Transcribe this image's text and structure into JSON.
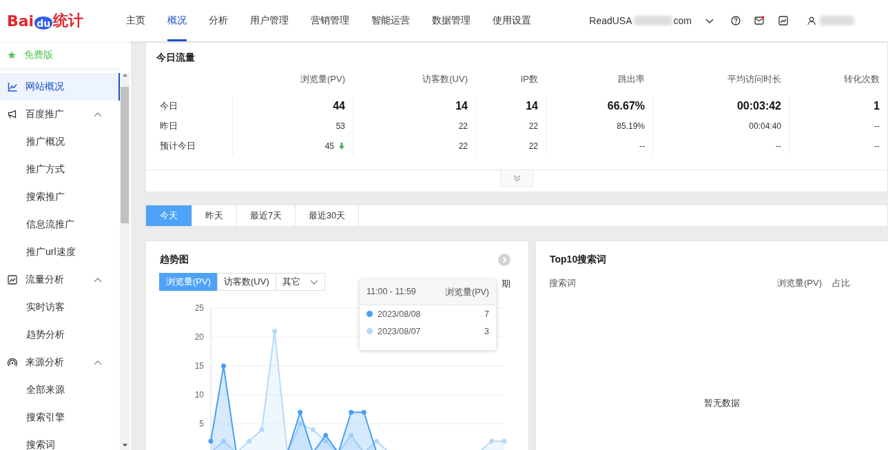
{
  "header": {
    "logo": {
      "part_1": "Bai",
      "part_2": "du",
      "part_3": "统计"
    },
    "nav": [
      {
        "label": "主页",
        "selected": false
      },
      {
        "label": "概况",
        "selected": true
      },
      {
        "label": "分析",
        "selected": false
      },
      {
        "label": "用户管理",
        "selected": false
      },
      {
        "label": "营销管理",
        "selected": false
      },
      {
        "label": "智能运营",
        "selected": false
      },
      {
        "label": "数据管理",
        "selected": false
      },
      {
        "label": "使用设置",
        "selected": false
      }
    ],
    "account": {
      "prefix": "ReadUSA",
      "suffix": "com"
    },
    "notifications_unread": true
  },
  "sidebar": {
    "edition": "免费版",
    "items": [
      {
        "label": "网站概况",
        "selected": true
      },
      {
        "label": "百度推广",
        "selected": false,
        "expanded": true,
        "children": [
          {
            "label": "推广概况",
            "selected": false
          },
          {
            "label": "推广方式",
            "selected": false
          },
          {
            "label": "搜索推广",
            "selected": false
          },
          {
            "label": "信息流推广",
            "selected": false
          },
          {
            "label": "推广url速度",
            "selected": false
          }
        ]
      },
      {
        "label": "流量分析",
        "selected": false,
        "expanded": true,
        "children": [
          {
            "label": "实时访客",
            "selected": false
          },
          {
            "label": "趋势分析",
            "selected": false
          }
        ]
      },
      {
        "label": "来源分析",
        "selected": false,
        "expanded": true,
        "children": [
          {
            "label": "全部来源",
            "selected": false
          },
          {
            "label": "搜索引擎",
            "selected": false
          },
          {
            "label": "搜索词",
            "selected": false
          }
        ]
      }
    ]
  },
  "today_traffic": {
    "title": "今日流量",
    "columns": [
      "浏览量(PV)",
      "访客数(UV)",
      "IP数",
      "跳出率",
      "平均访问时长",
      "转化次数"
    ],
    "rows": [
      {
        "label": "今日",
        "kind": "main",
        "cells": [
          "44",
          "14",
          "14",
          "66.67%",
          "00:03:42",
          "1"
        ]
      },
      {
        "label": "昨日",
        "kind": "normal",
        "cells": [
          "53",
          "22",
          "22",
          "85.19%",
          "00:04:40",
          "--"
        ]
      },
      {
        "label": "预计今日",
        "kind": "normal",
        "cells": [
          {
            "text": "45",
            "falling": true
          },
          "22",
          "22",
          "--",
          "--",
          "--"
        ]
      }
    ]
  },
  "date_tabs": [
    {
      "label": "今天",
      "selected": true
    },
    {
      "label": "昨天",
      "selected": false
    },
    {
      "label": "最近7天",
      "selected": false
    },
    {
      "label": "最近30天",
      "selected": false
    }
  ],
  "trend": {
    "title": "趋势图",
    "metrics": [
      {
        "label": "浏览量(PV)",
        "kind": "button",
        "selected": true
      },
      {
        "label": "访客数(UV)",
        "kind": "button",
        "selected": false
      },
      {
        "label": "其它",
        "kind": "dropdown",
        "selected": false
      }
    ],
    "compare_fragment": "期",
    "chart_data": {
      "type": "area",
      "grid": true,
      "ylim": [
        0,
        25
      ],
      "yticks": [
        5,
        10,
        15,
        20,
        25
      ],
      "series": [
        {
          "name": "2023/08/08",
          "color": "#4a9ff5",
          "values": [
            2,
            15,
            0,
            0,
            0,
            0,
            0,
            7,
            0,
            3,
            0,
            7,
            7,
            0,
            null,
            null,
            null,
            null,
            null,
            null,
            null,
            null,
            null,
            null
          ]
        },
        {
          "name": "2023/08/07",
          "color": "#b7d9fb",
          "values": [
            0,
            2,
            0,
            2,
            4,
            21,
            0,
            5,
            4,
            2,
            0,
            3,
            0,
            2,
            0,
            0,
            0,
            0,
            0,
            0,
            0,
            0,
            2,
            2
          ]
        }
      ]
    },
    "tooltip": {
      "time": "11:00 - 11:59",
      "metric": "浏览量(PV)",
      "values": [
        "7",
        "3"
      ]
    }
  },
  "top10": {
    "title": "Top10搜索词",
    "columns": [
      "搜索词",
      "浏览量(PV)",
      "占比"
    ],
    "empty": "暂无数据"
  }
}
